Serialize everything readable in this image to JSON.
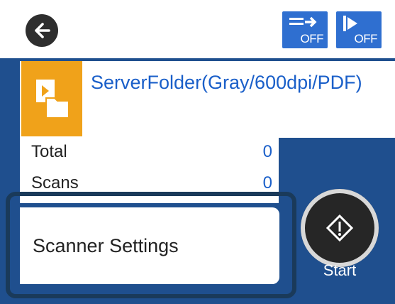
{
  "topbar": {
    "back_icon": "back-arrow-icon",
    "toggle_left": {
      "icon": "double-sided-arrow-icon",
      "label": "OFF"
    },
    "toggle_right": {
      "icon": "skip-blank-icon",
      "label": "OFF"
    }
  },
  "destination": {
    "icon": "folder-document-icon",
    "text": "ServerFolder(Gray/600dpi/PDF)"
  },
  "counters": [
    {
      "label": "Total",
      "value": "0"
    },
    {
      "label": "Scans",
      "value": "0"
    }
  ],
  "settings_button": {
    "label": "Scanner Settings"
  },
  "start_button": {
    "label": "Start",
    "icon": "start-diamond-icon"
  },
  "colors": {
    "accent_blue": "#2f6fd0",
    "panel_blue": "#1f4f8e",
    "text_blue": "#1a5fc9",
    "folder_orange": "#f0a21a"
  }
}
